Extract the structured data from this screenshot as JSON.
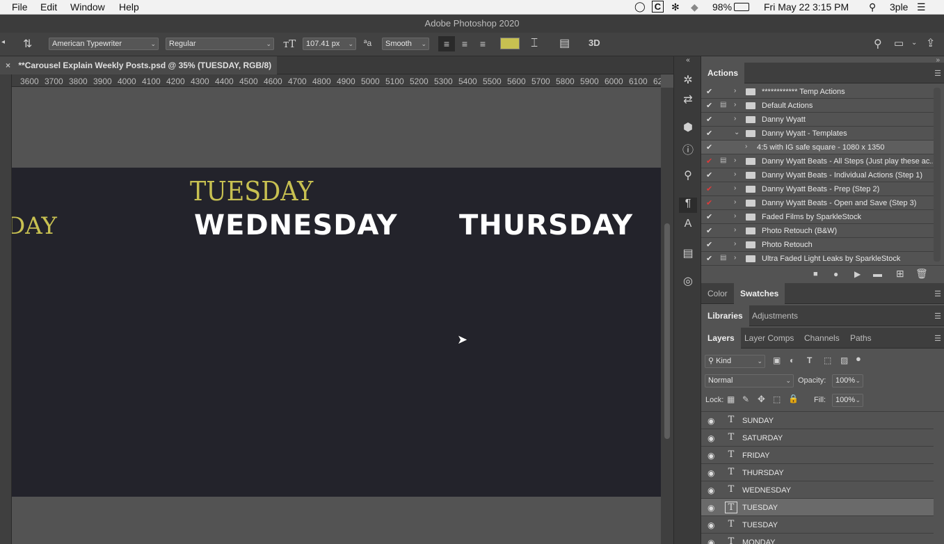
{
  "menubar": {
    "apple_menu": [
      {
        "label": "File"
      },
      {
        "label": "Edit"
      },
      {
        "label": "Window"
      },
      {
        "label": "Help"
      }
    ],
    "battery": "98%",
    "clock": "Fri May 22  3:15 PM",
    "user": "3ple"
  },
  "window": {
    "title": "Adobe Photoshop 2020"
  },
  "options_bar": {
    "font_family": "American Typewriter",
    "font_style": "Regular",
    "font_size": "107.41 px",
    "antialias": "Smooth",
    "text_color": "#c7c051"
  },
  "document": {
    "tab_title": "**Carousel Explain Weekly Posts.psd @ 35% (TUESDAY, RGB/8) *",
    "ruler_ticks": [
      "3600",
      "3700",
      "3800",
      "3900",
      "4000",
      "4100",
      "4200",
      "4300",
      "4400",
      "4500",
      "4600",
      "4700",
      "4800",
      "4900",
      "5000",
      "5100",
      "5200",
      "5300",
      "5400",
      "5500",
      "5600",
      "5700",
      "5800",
      "5900",
      "6000",
      "6100",
      "62"
    ]
  },
  "canvas": {
    "words": {
      "tuesday_serif": "TUESDAY",
      "partial_left": "DAY",
      "wednesday": "WEDNESDAY",
      "thursday": "THURSDAY"
    },
    "colors": {
      "accent": "#c7c051",
      "artboard": "#23232b",
      "white": "#ffffff"
    }
  },
  "actions_panel": {
    "tab": "Actions",
    "items": [
      {
        "label": "************ Temp Actions",
        "check": "✔",
        "red": false,
        "dialog": false,
        "expanded": false,
        "indent": 0
      },
      {
        "label": "Default Actions",
        "check": "✔",
        "red": false,
        "dialog": true,
        "expanded": false,
        "indent": 0
      },
      {
        "label": "Danny Wyatt",
        "check": "✔",
        "red": false,
        "dialog": false,
        "expanded": false,
        "indent": 0
      },
      {
        "label": "Danny Wyatt - Templates",
        "check": "✔",
        "red": false,
        "dialog": false,
        "expanded": true,
        "indent": 0
      },
      {
        "label": "4:5 with IG safe square - 1080 x 1350",
        "check": "✔",
        "red": false,
        "dialog": false,
        "expanded": false,
        "indent": 1
      },
      {
        "label": "Danny Wyatt Beats - All Steps (Just play these ac...",
        "check": "✔",
        "red": true,
        "dialog": true,
        "expanded": false,
        "indent": 0
      },
      {
        "label": "Danny Wyatt Beats - Individual Actions (Step 1)",
        "check": "✔",
        "red": false,
        "dialog": false,
        "expanded": false,
        "indent": 0
      },
      {
        "label": "Danny Wyatt Beats - Prep (Step 2)",
        "check": "✔",
        "red": true,
        "dialog": false,
        "expanded": false,
        "indent": 0
      },
      {
        "label": "Danny Wyatt Beats - Open and Save (Step 3)",
        "check": "✔",
        "red": true,
        "dialog": false,
        "expanded": false,
        "indent": 0
      },
      {
        "label": "Faded Films by SparkleStock",
        "check": "✔",
        "red": false,
        "dialog": false,
        "expanded": false,
        "indent": 0
      },
      {
        "label": "Photo Retouch (B&W)",
        "check": "✔",
        "red": false,
        "dialog": false,
        "expanded": false,
        "indent": 0
      },
      {
        "label": "Photo Retouch",
        "check": "✔",
        "red": false,
        "dialog": false,
        "expanded": false,
        "indent": 0
      },
      {
        "label": "Ultra Faded Light Leaks by SparkleStock",
        "check": "✔",
        "red": false,
        "dialog": true,
        "expanded": false,
        "indent": 0
      }
    ]
  },
  "color_panel": {
    "tabs": [
      {
        "label": "Color"
      },
      {
        "label": "Swatches"
      }
    ]
  },
  "libraries_panel": {
    "tabs": [
      {
        "label": "Libraries"
      },
      {
        "label": "Adjustments"
      }
    ]
  },
  "layers_panel": {
    "tabs": [
      {
        "label": "Layers"
      },
      {
        "label": "Layer Comps"
      },
      {
        "label": "Channels"
      },
      {
        "label": "Paths"
      }
    ],
    "filter_kind": "Kind",
    "blend_mode": "Normal",
    "opacity_label": "Opacity:",
    "opacity_value": "100%",
    "lock_label": "Lock:",
    "fill_label": "Fill:",
    "fill_value": "100%",
    "layers": [
      {
        "name": "SUNDAY",
        "selected": false
      },
      {
        "name": "SATURDAY",
        "selected": false
      },
      {
        "name": "FRIDAY",
        "selected": false
      },
      {
        "name": "THURSDAY",
        "selected": false
      },
      {
        "name": "WEDNESDAY",
        "selected": false
      },
      {
        "name": "TUESDAY",
        "selected": true
      },
      {
        "name": "TUESDAY",
        "selected": false
      },
      {
        "name": "MONDAY",
        "selected": false
      }
    ]
  }
}
